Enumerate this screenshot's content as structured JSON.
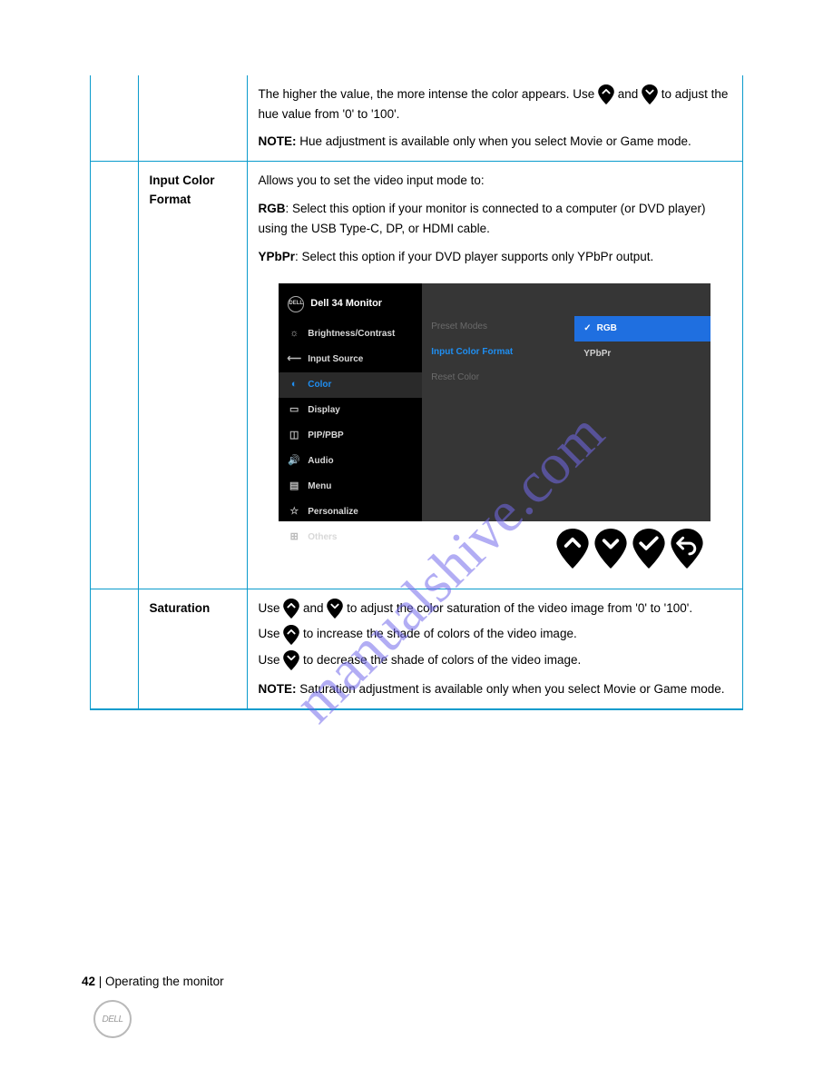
{
  "row1": {
    "text_before": "The higher the value, the more intense the color appears. Use ",
    "text_mid": " and ",
    "text_after": " to adjust the hue value from '0' to '100'.",
    "note_label": "NOTE:",
    "note_text": " Hue adjustment is available only when you select Movie or Game mode."
  },
  "row2": {
    "label": "Input Color Format",
    "intro": "Allows you to set the video input mode to:",
    "rgb_label": "RGB",
    "rgb_text": ": Select this option if your monitor is connected to a computer (or DVD player) using the USB Type-C, DP, or HDMI cable.",
    "ypbpr_label": "YPbPr",
    "ypbpr_text": ": Select this option if your DVD player supports only YPbPr output."
  },
  "osd": {
    "title": "Dell 34 Monitor",
    "menu": [
      "Brightness/Contrast",
      "Input Source",
      "Color",
      "Display",
      "PIP/PBP",
      "Audio",
      "Menu",
      "Personalize",
      "Others"
    ],
    "mid": [
      "Preset Modes",
      "Input Color Format",
      "Reset Color"
    ],
    "opts": [
      "RGB",
      "YPbPr"
    ]
  },
  "row3": {
    "label": "Saturation",
    "line1a": "Use ",
    "line1b": " and ",
    "line1c": " to adjust the color saturation of the video image from '0' to '100'.",
    "line2a": "Use ",
    "line2b": " to increase the shade of colors of the video image.",
    "line3a": "Use ",
    "line3b": " to decrease the shade of colors of the video image.",
    "note_label": "NOTE:",
    "note_text": " Saturation adjustment is available only when you select Movie or Game mode."
  },
  "footer": {
    "page": "42",
    "sep": "    |    ",
    "section": "Operating the monitor"
  },
  "badge": "DELL",
  "watermark": "manualshive.com"
}
